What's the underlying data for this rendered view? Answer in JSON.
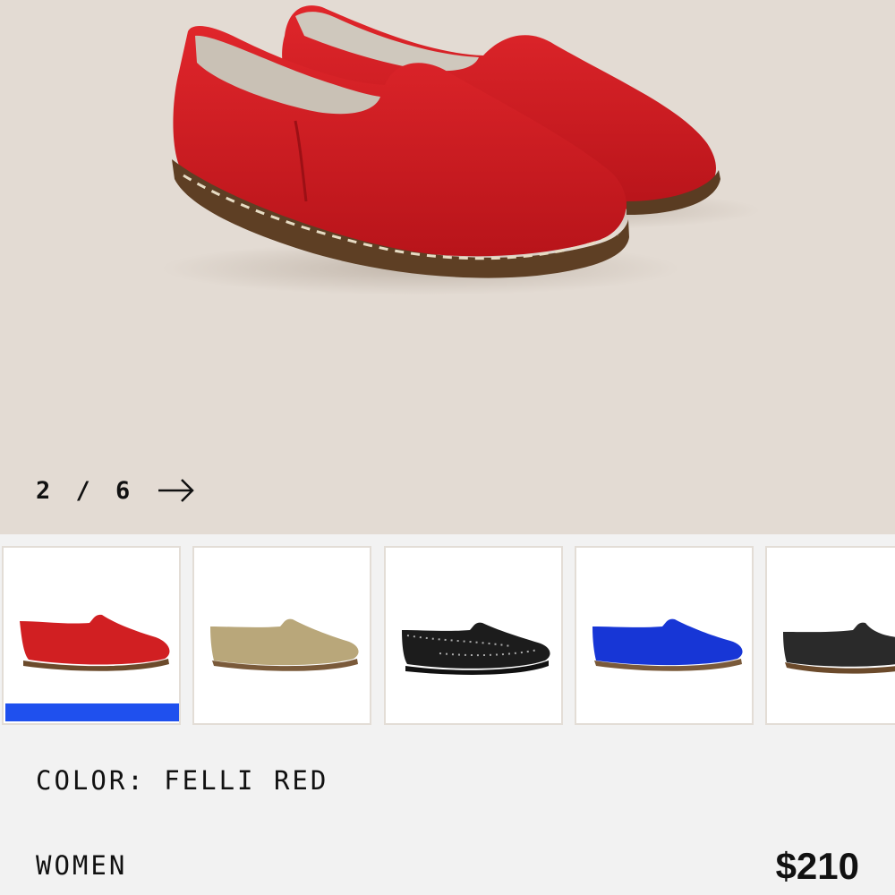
{
  "gallery": {
    "current_index": 2,
    "total": 6,
    "counter_text": "2 / 6",
    "next_icon": "arrow-right-icon",
    "main_image": "red leather slip-on shoes pair"
  },
  "thumbnails": [
    {
      "name": "thumbnail-felli-red",
      "color": "#d11f22",
      "sole": "#6b4a2b",
      "selected": true
    },
    {
      "name": "thumbnail-tan-suede",
      "color": "#b9a77a",
      "sole": "#7a5a3a",
      "selected": false
    },
    {
      "name": "thumbnail-black-studded",
      "color": "#1c1c1c",
      "sole": "#222222",
      "selected": false
    },
    {
      "name": "thumbnail-blue-suede",
      "color": "#1736d6",
      "sole": "#7a5a3a",
      "selected": false
    },
    {
      "name": "thumbnail-black-leather",
      "color": "#2a2a2a",
      "sole": "#6b4a2b",
      "selected": false
    }
  ],
  "product": {
    "color_label": "COLOR: FELLI RED",
    "gender": "WOMEN",
    "price": "$210"
  },
  "colors": {
    "hero_background": "#e3dbd3",
    "selected_indicator": "#1f50ee",
    "page_background": "#f2f2f2"
  }
}
